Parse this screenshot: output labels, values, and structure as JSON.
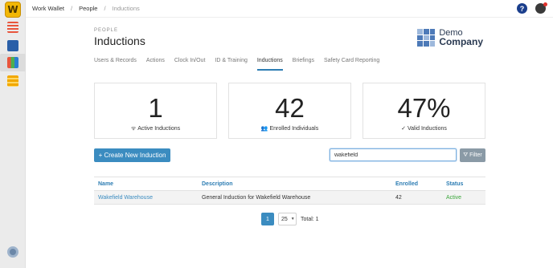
{
  "app": {
    "logo_letter": "W"
  },
  "breadcrumb": {
    "items": [
      "Work Wallet",
      "People",
      "Inductions"
    ],
    "separator": "/"
  },
  "header": {
    "help_label": "?"
  },
  "page": {
    "section_label": "PEOPLE",
    "title": "Inductions"
  },
  "company": {
    "line1": "Demo",
    "line2": "Company"
  },
  "tabs": [
    {
      "label": "Users & Records"
    },
    {
      "label": "Actions"
    },
    {
      "label": "Clock In/Out"
    },
    {
      "label": "ID & Training"
    },
    {
      "label": "Inductions",
      "active": true
    },
    {
      "label": "Briefings"
    },
    {
      "label": "Safety Card Reporting"
    }
  ],
  "stats": [
    {
      "value": "1",
      "icon": "wifi-icon",
      "glyph": "ᯤ",
      "label": "Active Inductions"
    },
    {
      "value": "42",
      "icon": "people-icon",
      "glyph": "👥",
      "label": "Enrolled Individuals"
    },
    {
      "value": "47%",
      "icon": "check-icon",
      "glyph": "✓",
      "label": "Valid Inductions"
    }
  ],
  "toolbar": {
    "create_label": "+ Create New Induction",
    "search_value": "wakefield",
    "filter_label": "⛛ Filter"
  },
  "table": {
    "columns": [
      "Name",
      "Description",
      "Enrolled",
      "Status"
    ],
    "rows": [
      {
        "name": "Wakefield Warehouse",
        "description": "General Induction for Wakefield Warehouse",
        "enrolled": "42",
        "status": "Active"
      }
    ]
  },
  "pagination": {
    "current_page": "1",
    "page_size": "25",
    "total_text": "Total: 1"
  },
  "colors": {
    "accent": "#3b8cc0",
    "active_status": "#3aa53a",
    "sidebar": "#ebebeb"
  }
}
